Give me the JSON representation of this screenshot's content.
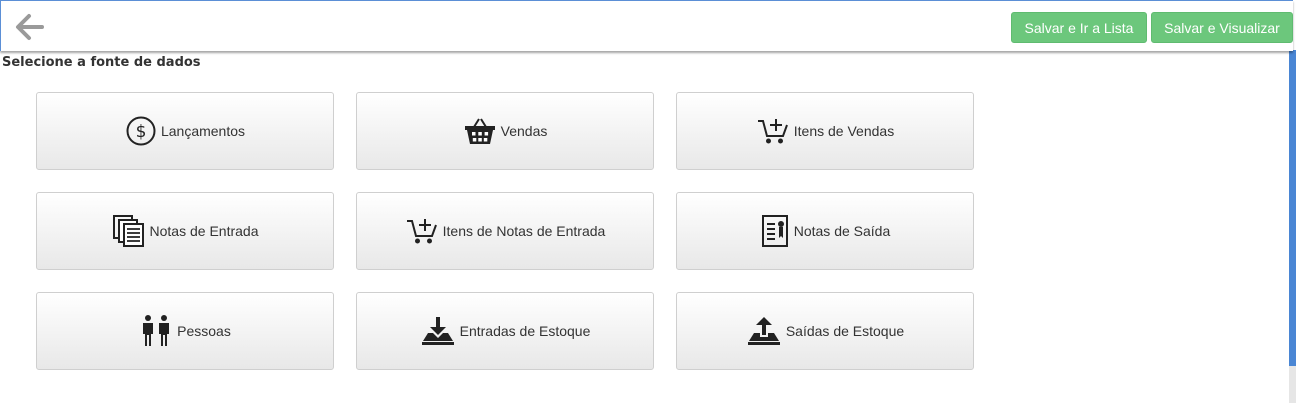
{
  "toolbar": {
    "back_icon": "arrow-left-icon",
    "save_list_label": "Salvar e Ir a Lista",
    "save_view_label": "Salvar e Visualizar",
    "accent_color": "#6cc77c"
  },
  "section": {
    "title": "Selecione a fonte de dados"
  },
  "sources": [
    {
      "label": "Lançamentos",
      "icon": "dollar-circle-icon"
    },
    {
      "label": "Vendas",
      "icon": "basket-icon"
    },
    {
      "label": "Itens de Vendas",
      "icon": "cart-add-icon"
    },
    {
      "label": "Notas de Entrada",
      "icon": "documents-icon"
    },
    {
      "label": "Itens de Notas de Entrada",
      "icon": "cart-add-icon"
    },
    {
      "label": "Notas de Saída",
      "icon": "certificate-icon"
    },
    {
      "label": "Pessoas",
      "icon": "people-icon"
    },
    {
      "label": "Entradas de Estoque",
      "icon": "tray-download-icon"
    },
    {
      "label": "Saídas de Estoque",
      "icon": "tray-upload-icon"
    }
  ]
}
